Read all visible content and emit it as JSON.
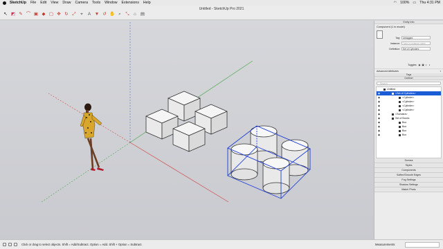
{
  "menubar": {
    "app": "SketchUp",
    "items": [
      "File",
      "Edit",
      "View",
      "Draw",
      "Camera",
      "Tools",
      "Window",
      "Extensions",
      "Help"
    ],
    "battery": "100%",
    "clock": "Thu 4:31 PM"
  },
  "window": {
    "title": "Untitled - SketchUp Pro 2021"
  },
  "toolbar": {
    "tools": [
      {
        "name": "select-tool",
        "glyph": "↖",
        "color": "#222222"
      },
      {
        "name": "eraser-tool",
        "glyph": "◩",
        "color": "#d0305a"
      },
      {
        "name": "line-tool",
        "glyph": "✎",
        "color": "#c0392b"
      },
      {
        "name": "arc-tool",
        "glyph": "⌒",
        "color": "#c0392b"
      },
      {
        "name": "shapes-tool",
        "glyph": "▣",
        "color": "#c0392b"
      },
      {
        "name": "push-pull-tool",
        "glyph": "◆",
        "color": "#c0392b"
      },
      {
        "name": "offset-tool",
        "glyph": "▢",
        "color": "#c0392b"
      },
      {
        "name": "move-tool",
        "glyph": "✥",
        "color": "#c0392b"
      },
      {
        "name": "rotate-tool",
        "glyph": "↻",
        "color": "#c0392b"
      },
      {
        "name": "scale-tool",
        "glyph": "⤢",
        "color": "#c0392b"
      },
      {
        "name": "tape-measure-tool",
        "glyph": "⌖",
        "color": "#555555"
      },
      {
        "name": "text-tool",
        "glyph": "A",
        "color": "#555555"
      },
      {
        "name": "paint-bucket-tool",
        "glyph": "▼",
        "color": "#c0392b"
      },
      {
        "name": "orbit-tool",
        "glyph": "↺",
        "color": "#c0392b"
      },
      {
        "name": "pan-tool",
        "glyph": "✋",
        "color": "#555555"
      },
      {
        "name": "zoom-tool",
        "glyph": "⌕",
        "color": "#555555"
      },
      {
        "name": "zoom-extents-tool",
        "glyph": "⤡",
        "color": "#c0392b"
      },
      {
        "name": "warehouse-tool",
        "glyph": "⌂",
        "color": "#555555"
      },
      {
        "name": "extension-warehouse-tool",
        "glyph": "▤",
        "color": "#555555"
      }
    ]
  },
  "entity_info": {
    "header": "Entity Info",
    "component": "Component (1 in model)",
    "tag_label": "Tag:",
    "tag_value": "Untagged",
    "instance_label": "Instance:",
    "instance_placeholder": "Type in instance name",
    "definition_label": "Definition:",
    "definition_value": "Set of Cylinders",
    "toggles_label": "Toggles:",
    "advanced": "Advanced Attributes"
  },
  "tags_panel": {
    "header": "Tags"
  },
  "outliner": {
    "header": "Outliner",
    "search_placeholder": "Search",
    "rows": [
      {
        "label": "Untitled",
        "indent": 10,
        "eye": false,
        "selected": false
      },
      {
        "label": "<Set of Cylinders>",
        "indent": 22,
        "eye": true,
        "selected": true
      },
      {
        "label": "<Cylinder>",
        "indent": 32,
        "eye": true,
        "selected": false
      },
      {
        "label": "<Cylinder>",
        "indent": 32,
        "eye": true,
        "selected": false
      },
      {
        "label": "<Cylinder>",
        "indent": 32,
        "eye": true,
        "selected": false
      },
      {
        "label": "<Cylinder>",
        "indent": 32,
        "eye": true,
        "selected": false
      },
      {
        "label": "<Sumaira>",
        "indent": 22,
        "eye": true,
        "selected": false
      },
      {
        "label": "Set of Boxes",
        "indent": 22,
        "eye": true,
        "selected": false
      },
      {
        "label": "Box",
        "indent": 32,
        "eye": true,
        "selected": false
      },
      {
        "label": "Box",
        "indent": 32,
        "eye": true,
        "selected": false
      },
      {
        "label": "Box",
        "indent": 32,
        "eye": true,
        "selected": false
      },
      {
        "label": "Box",
        "indent": 32,
        "eye": true,
        "selected": false
      }
    ]
  },
  "collapsed_panels": [
    "Scenes",
    "Styles",
    "Components",
    "Soften/Smooth Edges",
    "Fog Settings",
    "Shadow Settings",
    "Match Photo"
  ],
  "status": {
    "hint": "Click or drag to select objects. Shift = Add/Subtract. Option = Add. Shift + Option = Subtract.",
    "measurements_label": "Measurements"
  },
  "colors": {
    "selection": "#1a5cd6",
    "axis_red": "#d04a4a",
    "axis_green": "#4aa84a",
    "axis_blue": "#4a6ad0",
    "figure_dress": "#d8a62a"
  }
}
